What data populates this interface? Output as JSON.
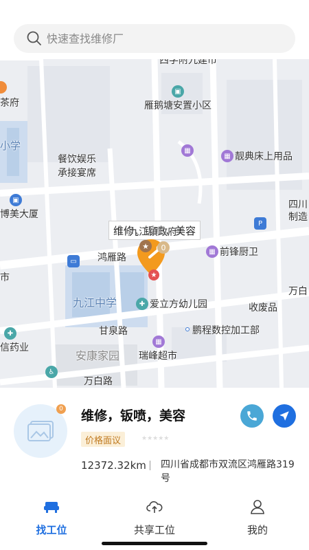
{
  "search": {
    "placeholder": "快速查找维修厂"
  },
  "map": {
    "callout": "维修，钣喷，美容",
    "pin_count": "0",
    "labels": {
      "top_cut": "西学附九建市",
      "cha": "茶府",
      "yanetang": "雁鹅塘安置小区",
      "xiaoxue": "小学",
      "canyin1": "餐饮娱乐",
      "canyin2": "承接宴席",
      "liangdian": "靓典床上用品",
      "bomei": "博美大厦",
      "sichuan1": "四川",
      "sichuan2": "制造",
      "jiujiang_gov": "九江镇政府",
      "hongyan": "鸿雁路",
      "qianfeng": "前锋厨卫",
      "shi": "市",
      "jiujiang_school": "九江中学",
      "aili": "爱立方幼儿园",
      "shougou": "收废品",
      "wanbai_right": "万白",
      "ganquan": "甘泉路",
      "pengcheng": "鹏程数控加工部",
      "xinyaoye": "信药业",
      "ankang": "安康家园",
      "ruifeng": "瑞峰超市",
      "wanbai": "万白路"
    }
  },
  "card": {
    "badge": "0",
    "shop_name": "维修，钣喷，美容",
    "price_tag": "价格面议",
    "stars": "★★★★★",
    "distance": "12372.32km",
    "address": "四川省成都市双流区鸿雁路319号"
  },
  "tabs": [
    {
      "label": "找工位",
      "active": true
    },
    {
      "label": "共享工位",
      "active": false
    },
    {
      "label": "我的",
      "active": false
    }
  ],
  "colors": {
    "accent": "#1f6fe0",
    "pin": "#f39a1e",
    "price_bg": "#fbefd8"
  }
}
